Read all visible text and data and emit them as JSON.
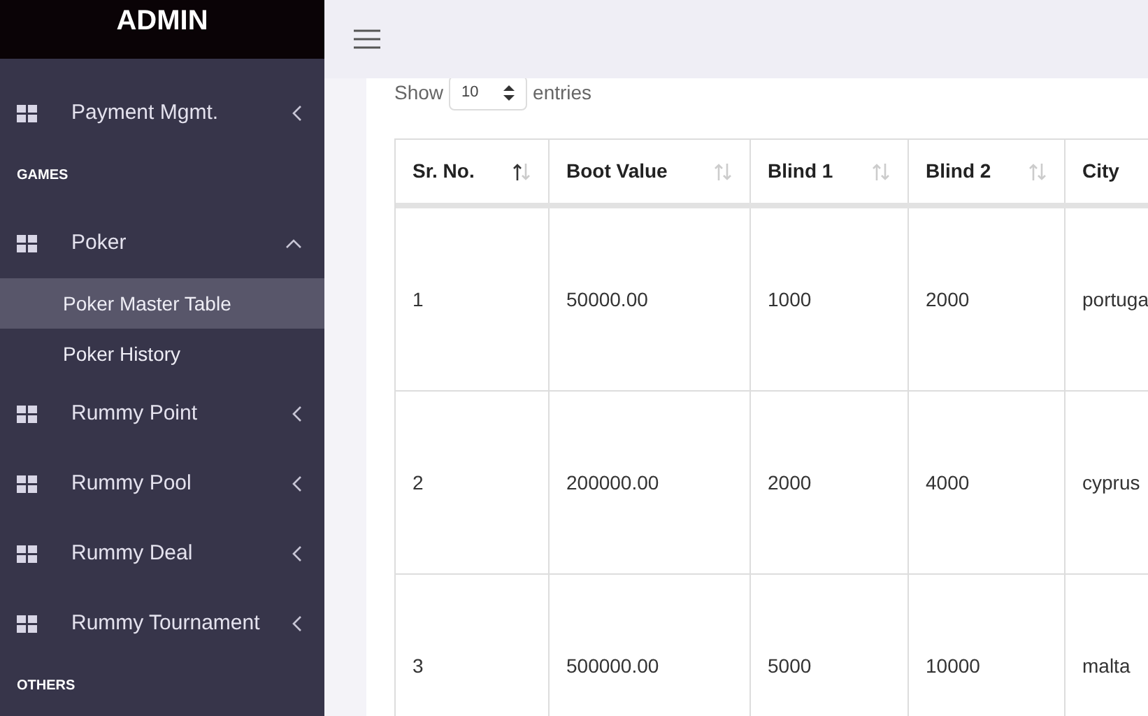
{
  "brand": "ADMIN",
  "sidebar": {
    "items": [
      {
        "kind": "group",
        "label": "Payment Mgmt.",
        "expanded": false
      },
      {
        "kind": "section",
        "label": "GAMES"
      },
      {
        "kind": "group",
        "label": "Poker",
        "expanded": true,
        "children": [
          {
            "label": "Poker Master Table",
            "selected": true
          },
          {
            "label": "Poker History",
            "selected": false
          }
        ]
      },
      {
        "kind": "group",
        "label": "Rummy Point",
        "expanded": false
      },
      {
        "kind": "group",
        "label": "Rummy Pool",
        "expanded": false
      },
      {
        "kind": "group",
        "label": "Rummy Deal",
        "expanded": false
      },
      {
        "kind": "group",
        "label": "Rummy Tournament",
        "expanded": false
      },
      {
        "kind": "section",
        "label": "OTHERS"
      }
    ]
  },
  "length_menu": {
    "before": "Show",
    "value": "10",
    "after": "entries"
  },
  "table": {
    "columns": [
      {
        "label": "Sr. No.",
        "sorted": true
      },
      {
        "label": "Boot Value",
        "sorted": false
      },
      {
        "label": "Blind 1",
        "sorted": false
      },
      {
        "label": "Blind 2",
        "sorted": false
      },
      {
        "label": "City"
      }
    ],
    "rows": [
      [
        "1",
        "50000.00",
        "1000",
        "2000",
        "portuga"
      ],
      [
        "2",
        "200000.00",
        "2000",
        "4000",
        "cyprus"
      ],
      [
        "3",
        "500000.00",
        "5000",
        "10000",
        "malta"
      ]
    ]
  }
}
